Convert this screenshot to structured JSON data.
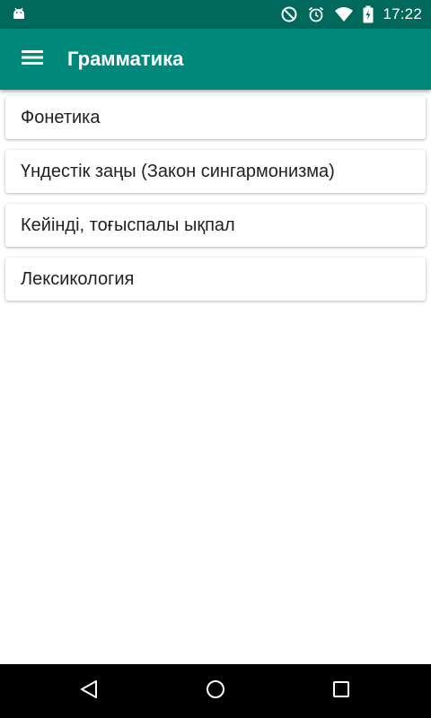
{
  "status_bar": {
    "time": "17:22",
    "icons": [
      "android-notification-icon",
      "do-not-disturb-icon",
      "alarm-icon",
      "wifi-icon",
      "battery-charging-icon"
    ]
  },
  "app_bar": {
    "title": "Грамматика",
    "menu_icon": "hamburger-menu-icon"
  },
  "list": {
    "items": [
      {
        "label": "Фонетика"
      },
      {
        "label": "Үндестік заңы (Закон сингармонизма)"
      },
      {
        "label": "Кейінді, тоғыспалы ықпал"
      },
      {
        "label": "Лексикология"
      }
    ]
  },
  "nav_bar": {
    "icons": [
      "back-icon",
      "home-icon",
      "recents-icon"
    ]
  },
  "colors": {
    "status_bar": "#00695c",
    "app_bar": "#00897b",
    "background": "#ffffff",
    "text": "#212121",
    "nav_bar": "#000000"
  }
}
